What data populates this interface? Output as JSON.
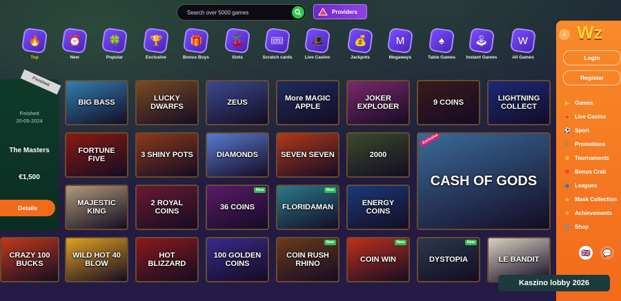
{
  "search": {
    "placeholder": "Search over 5000 games"
  },
  "providers_label": "Providers",
  "categories": [
    {
      "label": "Top",
      "icon": "flame-icon",
      "glyph": "🔥"
    },
    {
      "label": "New",
      "icon": "clock-icon",
      "glyph": "⏰"
    },
    {
      "label": "Popular",
      "icon": "clover-icon",
      "glyph": "🍀"
    },
    {
      "label": "Exclusive",
      "icon": "trophy-icon",
      "glyph": "🏆"
    },
    {
      "label": "Bonus Buys",
      "icon": "gift-icon",
      "glyph": "🎁"
    },
    {
      "label": "Slots",
      "icon": "cherry-icon",
      "glyph": "🍒"
    },
    {
      "label": "Scratch cards",
      "icon": "scratch-card-icon",
      "glyph": "🎟"
    },
    {
      "label": "Live Casino",
      "icon": "dealer-icon",
      "glyph": "🎩"
    },
    {
      "label": "Jackpots",
      "icon": "money-bag-icon",
      "glyph": "💰"
    },
    {
      "label": "Megaways",
      "icon": "megaways-icon",
      "glyph": "M"
    },
    {
      "label": "Table Games",
      "icon": "spade-card-icon",
      "glyph": "♠"
    },
    {
      "label": "Instant Games",
      "icon": "joystick-icon",
      "glyph": "🕹"
    },
    {
      "label": "All Games",
      "icon": "all-games-icon",
      "glyph": "W"
    }
  ],
  "promo": {
    "ribbon": "Finished",
    "status": "Finished",
    "date": "20-05-2024",
    "title": "The Masters",
    "prize": "€1,500",
    "details_label": "Details"
  },
  "games": [
    {
      "title": "BIG BASS",
      "bg": "#2f7fb0",
      "badge": ""
    },
    {
      "title": "LUCKY DWARFS",
      "bg": "#7a4a22",
      "badge": ""
    },
    {
      "title": "ZEUS",
      "bg": "#3b4a8c",
      "badge": ""
    },
    {
      "title": "More MAGIC APPLE",
      "bg": "#1f2b5c",
      "badge": ""
    },
    {
      "title": "JOKER EXPLODER",
      "bg": "#7a2a6a",
      "badge": ""
    },
    {
      "title": "9 COINS",
      "bg": "#3a1a1a",
      "badge": ""
    },
    {
      "title": "LIGHTNING COLLECT",
      "bg": "#1a2a7a",
      "badge": ""
    },
    {
      "title": "FORTUNE FIVE",
      "bg": "#8a1a10",
      "badge": ""
    },
    {
      "title": "3 SHINY POTS",
      "bg": "#8a3a1a",
      "badge": ""
    },
    {
      "title": "DIAMONDS",
      "bg": "#5a7ad0",
      "badge": ""
    },
    {
      "title": "SEVEN SEVEN",
      "bg": "#b2381a",
      "badge": ""
    },
    {
      "title": "2000",
      "bg": "#3a4a2a",
      "badge": ""
    },
    {
      "title": "CASH OF GODS",
      "bg": "#3a6a9a",
      "badge": "Exclusive"
    },
    {
      "title": "MAJESTIC KING",
      "bg": "#b09a7a",
      "badge": ""
    },
    {
      "title": "2 ROYAL COINS",
      "bg": "#6a1a30",
      "badge": ""
    },
    {
      "title": "36 COINS",
      "bg": "#5a1a6a",
      "badge": "New"
    },
    {
      "title": "FLORIDAMAN",
      "bg": "#2a7a8a",
      "badge": "New"
    },
    {
      "title": "ENERGY COINS",
      "bg": "#1a3a7a",
      "badge": ""
    },
    {
      "title": "CRAZY 100 BUCKS",
      "bg": "#c03a1a",
      "badge": ""
    },
    {
      "title": "WILD HOT 40 BLOW",
      "bg": "#e0a020",
      "badge": ""
    },
    {
      "title": "HOT BLIZZARD",
      "bg": "#8a1a1a",
      "badge": ""
    },
    {
      "title": "100 GOLDEN COINS",
      "bg": "#3a2a8a",
      "badge": ""
    },
    {
      "title": "COIN RUSH RHINO",
      "bg": "#6a3a1a",
      "badge": "New"
    },
    {
      "title": "COIN WIN",
      "bg": "#c0301a",
      "badge": "New"
    },
    {
      "title": "DYSTOPIA",
      "bg": "#2a3a4a",
      "badge": "New"
    },
    {
      "title": "LE BANDIT",
      "bg": "#d8d0c0",
      "badge": ""
    }
  ],
  "sidebar": {
    "logo": "Wz",
    "login_label": "Login",
    "register_label": "Register",
    "menu": [
      {
        "label": "Games",
        "icon": "play-icon",
        "glyph": "▶",
        "color": "#f0c13b"
      },
      {
        "label": "Live Casino",
        "icon": "dealer-icon",
        "glyph": "●",
        "color": "#e0304a"
      },
      {
        "label": "Sport",
        "icon": "ball-icon",
        "glyph": "⚽",
        "color": "#ffffff"
      },
      {
        "label": "Promotions",
        "icon": "megaphone-icon",
        "glyph": "✦",
        "color": "#4ab34a"
      },
      {
        "label": "Tournaments",
        "icon": "trophy-icon",
        "glyph": "♛",
        "color": "#f0c13b"
      },
      {
        "label": "Bonus Crab",
        "icon": "crab-icon",
        "glyph": "✺",
        "color": "#e04a2a"
      },
      {
        "label": "Leagues",
        "icon": "shield-icon",
        "glyph": "◆",
        "color": "#3a6ad0"
      },
      {
        "label": "Mask Collection",
        "icon": "mask-icon",
        "glyph": "☻",
        "color": "#f0c13b"
      },
      {
        "label": "Achievements",
        "icon": "medal-icon",
        "glyph": "★",
        "color": "#f0c13b"
      },
      {
        "label": "Shop",
        "icon": "shop-icon",
        "glyph": "✿",
        "color": "#3aa0e0"
      }
    ],
    "language": "🇬🇧"
  },
  "watermark": "Kaszino lobby 2026"
}
